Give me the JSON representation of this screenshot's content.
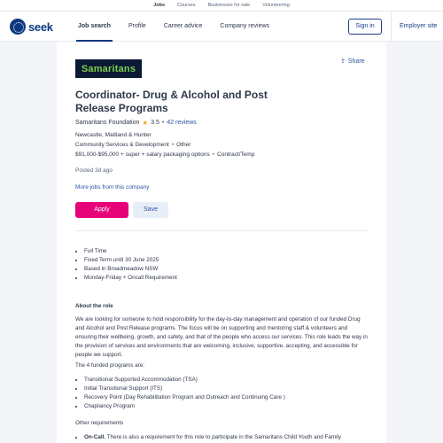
{
  "topbar": {
    "links": [
      "Jobs",
      "Courses",
      "Businesses for sale",
      "Volunteering"
    ]
  },
  "header": {
    "logo_text": "seek",
    "nav": [
      "Job search",
      "Profile",
      "Career advice",
      "Company reviews"
    ],
    "signin": "Sign in",
    "employer_site": "Employer site"
  },
  "job": {
    "company_logo_text": "Samaritans",
    "share": "Share",
    "title": "Coordinator- Drug & Alcohol and Post Release Programs",
    "advertiser": "Samaritans Foundation",
    "rating": "3.5",
    "reviews": "42 reviews",
    "location": "Newcastle, Maitland & Hunter",
    "classification": "Community Services & Development",
    "subclassification": "Other",
    "salary": "$91,000-$95,000 + super + salary packaging options",
    "work_type": "Contract/Temp",
    "posted": "Posted 3d ago",
    "more_jobs": "More jobs from this company",
    "apply": "Apply",
    "save": "Save"
  },
  "description": {
    "highlights": [
      "Full Time",
      "Fixed Term until 30 June 2025",
      "Based in Broadmeadow NSW",
      "Monday-Friday + Oncall Requirement"
    ],
    "about_heading": "About the role",
    "about_text": "We are looking for someone to hold responsibility for the day-to-day management and operation of our funded Drug and Alcohol and Post Release programs. The focus will be on supporting and mentoring staff & volunteers and ensuring their wellbeing, growth, and safety, and that of the people who access our services. This role leads the way in the provision of services and environments that are welcoming, inclusive, supportive, accepting, and accessible for people we support.",
    "funded_heading": "The 4 funded programs are:",
    "programs": [
      "Transitional Supported Accommodation (TSA)",
      "Initial Transitional Support (ITS)",
      "Recovery Point  (Day Rehabilitation Program and Outreach and Continuing Care )",
      "Chaplaincy Program"
    ],
    "other_heading": "Other requirements",
    "oncall_label": "On-Call.",
    "oncall_text": " There is also a requirement for this role to participate in the Samaritans Child Youth and Family"
  },
  "colors": {
    "brand_navy": "#0d3880",
    "apply_pink": "#e60278",
    "link_blue": "#2954a3",
    "logo_green": "#7bd04a"
  }
}
